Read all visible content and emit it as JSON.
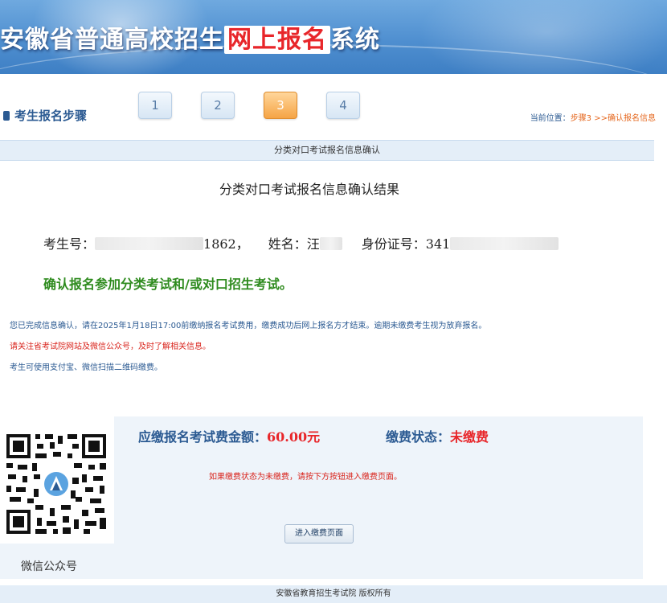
{
  "header": {
    "title_prefix": "安徽省普通高校招生",
    "title_highlight": "网上报名",
    "title_suffix": "系统"
  },
  "steps": {
    "label": "考生报名步骤",
    "items": [
      "1",
      "2",
      "3",
      "4"
    ],
    "active_index": 2,
    "breadcrumb_prefix": "当前位置：",
    "breadcrumb_current": "步骤3 >>确认报名信息"
  },
  "section": {
    "bar_title": "分类对口考试报名信息确认",
    "result_title": "分类对口考试报名信息确认结果"
  },
  "candidate": {
    "exam_no_label": "考生号：",
    "exam_no_end": "1862，",
    "name_label": "姓名：",
    "name_start": "汪",
    "id_label": "身份证号：",
    "id_start": "341"
  },
  "confirm_text": "确认报名参加分类考试和/或对口招生考试。",
  "notices": {
    "line1": "您已完成信息确认，请在2025年1月18日17:00前缴纳报名考试费用，缴费成功后网上报名方才结束。逾期未缴费考生视为放弃报名。",
    "line2": "请关注省考试院网站及微信公众号，及时了解相关信息。",
    "line3": "考生可使用支付宝、微信扫描二维码缴费。"
  },
  "payment": {
    "qr_label": "微信公众号",
    "fee_label": "应缴报名考试费金额：",
    "fee_amount": "60.00元",
    "status_label": "缴费状态：",
    "status_value": "未缴费",
    "tip": "如果缴费状态为未缴费，请按下方按钮进入缴费页面。",
    "button_label": "进入缴费页面"
  },
  "footer": "安徽省教育招生考试院 版权所有",
  "colors": {
    "brand_blue": "#2b5a92",
    "accent_red": "#e8262a",
    "confirm_green": "#2e8b1e",
    "active_step": "#f5a445"
  }
}
